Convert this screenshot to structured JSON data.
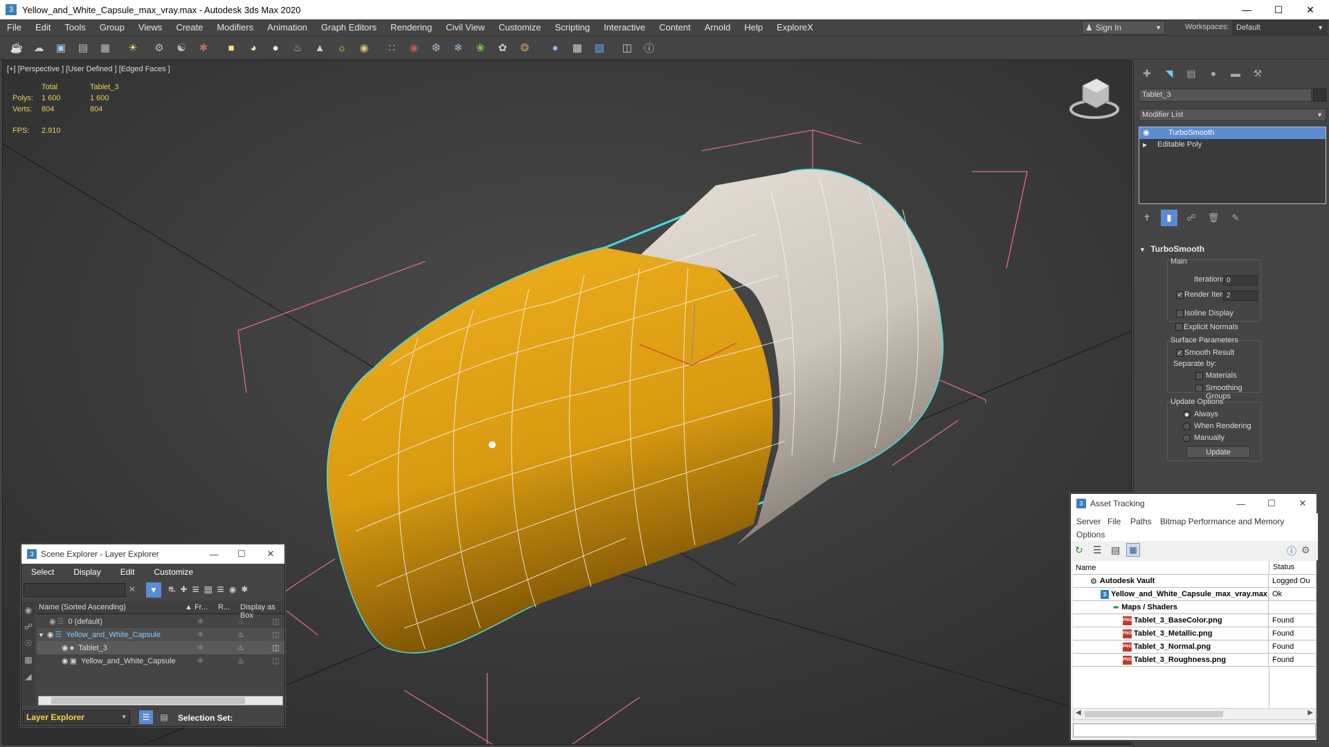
{
  "app": {
    "title": "Yellow_and_White_Capsule_max_vray.max - Autodesk 3ds Max 2020"
  },
  "menu": [
    "File",
    "Edit",
    "Tools",
    "Group",
    "Views",
    "Create",
    "Modifiers",
    "Animation",
    "Graph Editors",
    "Rendering",
    "Civil View",
    "Customize",
    "Scripting",
    "Interactive",
    "Content",
    "Arnold",
    "Help",
    "ExploreX"
  ],
  "account": {
    "sign_in": "Sign In"
  },
  "workspace": {
    "label": "Workspaces:",
    "value": "Default"
  },
  "viewport": {
    "label": "[+] [Perspective ] [User Defined ] [Edged Faces ]",
    "stats": {
      "col_total": "Total",
      "col_object": "Tablet_3",
      "polys_label": "Polys:",
      "polys_total": "1 600",
      "polys_object": "1 600",
      "verts_label": "Verts:",
      "verts_total": "804",
      "verts_object": "804",
      "fps_label": "FPS:",
      "fps_value": "2.910"
    }
  },
  "command_panel": {
    "object_name": "Tablet_3",
    "modifier_list": "Modifier List",
    "stack": [
      "TurboSmooth",
      "Editable Poly"
    ],
    "rollout": "TurboSmooth",
    "main_group": "Main",
    "iterations_label": "Iterations:",
    "iterations_value": "0",
    "render_iters_label": "Render Iters:",
    "render_iters_value": "2",
    "isoline_display": "Isoline Display",
    "explicit_normals": "Explicit Normals",
    "surface_group": "Surface Parameters",
    "smooth_result": "Smooth Result",
    "separate_by": "Separate by:",
    "materials": "Materials",
    "smoothing_groups": "Smoothing Groups",
    "update_group": "Update Options",
    "always": "Always",
    "when_rendering": "When Rendering",
    "manually": "Manually",
    "update_button": "Update"
  },
  "scene_explorer": {
    "title": "Scene Explorer - Layer Explorer",
    "menu": [
      "Select",
      "Display",
      "Edit",
      "Customize"
    ],
    "columns": [
      "Name (Sorted Ascending)",
      "▲ Fr...",
      "R...",
      "Display as Box"
    ],
    "rows": [
      {
        "name": "0 (default)"
      },
      {
        "name": "Yellow_and_White_Capsule"
      },
      {
        "name": "Tablet_3"
      },
      {
        "name": "Yellow_and_White_Capsule"
      }
    ],
    "layer_dropdown": "Layer Explorer",
    "selection_set": "Selection Set:"
  },
  "asset_tracking": {
    "title": "Asset Tracking",
    "menu": [
      "Server",
      "File",
      "Paths",
      "Bitmap Performance and Memory",
      "Options"
    ],
    "columns": [
      "Name",
      "Status"
    ],
    "rows": [
      {
        "name": "Autodesk Vault",
        "status": "Logged Ou"
      },
      {
        "name": "Yellow_and_White_Capsule_max_vray.max",
        "status": "Ok"
      },
      {
        "name": "Maps / Shaders",
        "status": ""
      },
      {
        "name": "Tablet_3_BaseColor.png",
        "status": "Found"
      },
      {
        "name": "Tablet_3_Metallic.png",
        "status": "Found"
      },
      {
        "name": "Tablet_3_Normal.png",
        "status": "Found"
      },
      {
        "name": "Tablet_3_Roughness.png",
        "status": "Found"
      }
    ]
  },
  "colors": {
    "capsule_yellow": "#d79a12",
    "capsule_white": "#d9d2c8",
    "selection_outline": "#3fe0e8",
    "bbox_pink": "#e06b8a",
    "stats_text": "#e8d160",
    "highlight_blue": "#5b8bd2"
  }
}
